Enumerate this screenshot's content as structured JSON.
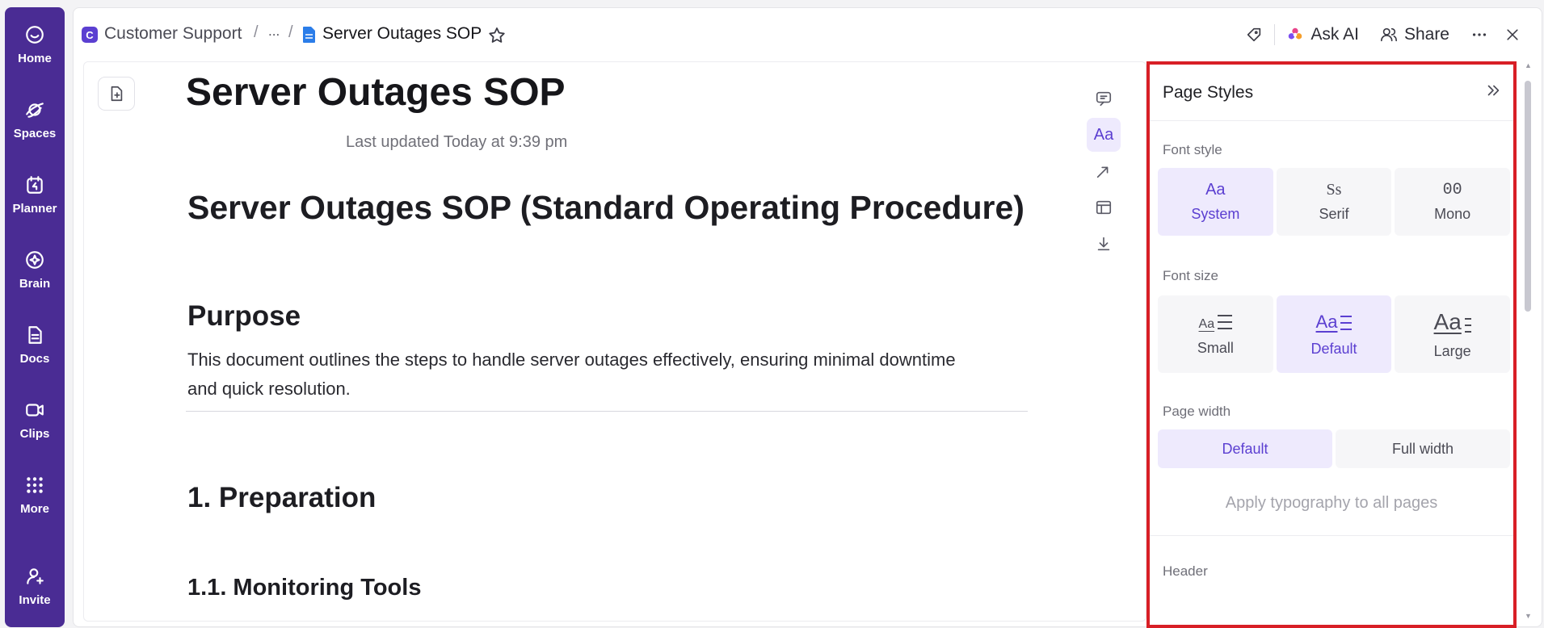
{
  "rail": {
    "items": [
      {
        "label": "Home",
        "icon": "home-icon"
      },
      {
        "label": "Spaces",
        "icon": "planet-icon"
      },
      {
        "label": "Planner",
        "icon": "calendar-icon"
      },
      {
        "label": "Brain",
        "icon": "brain-icon"
      },
      {
        "label": "Docs",
        "icon": "doc-icon"
      },
      {
        "label": "Clips",
        "icon": "video-icon"
      },
      {
        "label": "More",
        "icon": "grid-icon"
      }
    ],
    "invite_label": "Invite"
  },
  "breadcrumb": {
    "space_initial": "C",
    "space_name": "Customer Support",
    "ellipsis": "...",
    "current": "Server Outages SOP"
  },
  "topbar": {
    "ask_ai_label": "Ask AI",
    "share_label": "Share"
  },
  "document": {
    "title": "Server Outages SOP",
    "last_updated": "Last updated Today at 9:39 pm",
    "heading1": "Server Outages SOP (Standard Operating Procedure)",
    "section_purpose": "Purpose",
    "purpose_text": "This document outlines the steps to handle server outages effectively, ensuring minimal downtime and quick resolution.",
    "section_preparation": "1. Preparation",
    "section_monitoring": "1.1. Monitoring Tools"
  },
  "doc_tools": {
    "typography_label": "Aa"
  },
  "panel": {
    "title": "Page Styles",
    "font_style_label": "Font style",
    "font_styles": [
      {
        "glyph": "Aa",
        "name": "System",
        "selected": true
      },
      {
        "glyph": "Ss",
        "name": "Serif",
        "selected": false
      },
      {
        "glyph": "00",
        "name": "Mono",
        "selected": false
      }
    ],
    "font_size_label": "Font size",
    "font_sizes": [
      {
        "glyph": "Aa",
        "name": "Small",
        "selected": false
      },
      {
        "glyph": "Aa",
        "name": "Default",
        "selected": true
      },
      {
        "glyph": "Aa",
        "name": "Large",
        "selected": false
      }
    ],
    "page_width_label": "Page width",
    "page_widths": [
      {
        "name": "Default",
        "selected": true
      },
      {
        "name": "Full width",
        "selected": false
      }
    ],
    "apply_link": "Apply typography to all pages",
    "header_label": "Header"
  },
  "colors": {
    "rail": "#4a2c94",
    "accent": "#5b3fd1",
    "highlight_box": "#d81f26"
  }
}
